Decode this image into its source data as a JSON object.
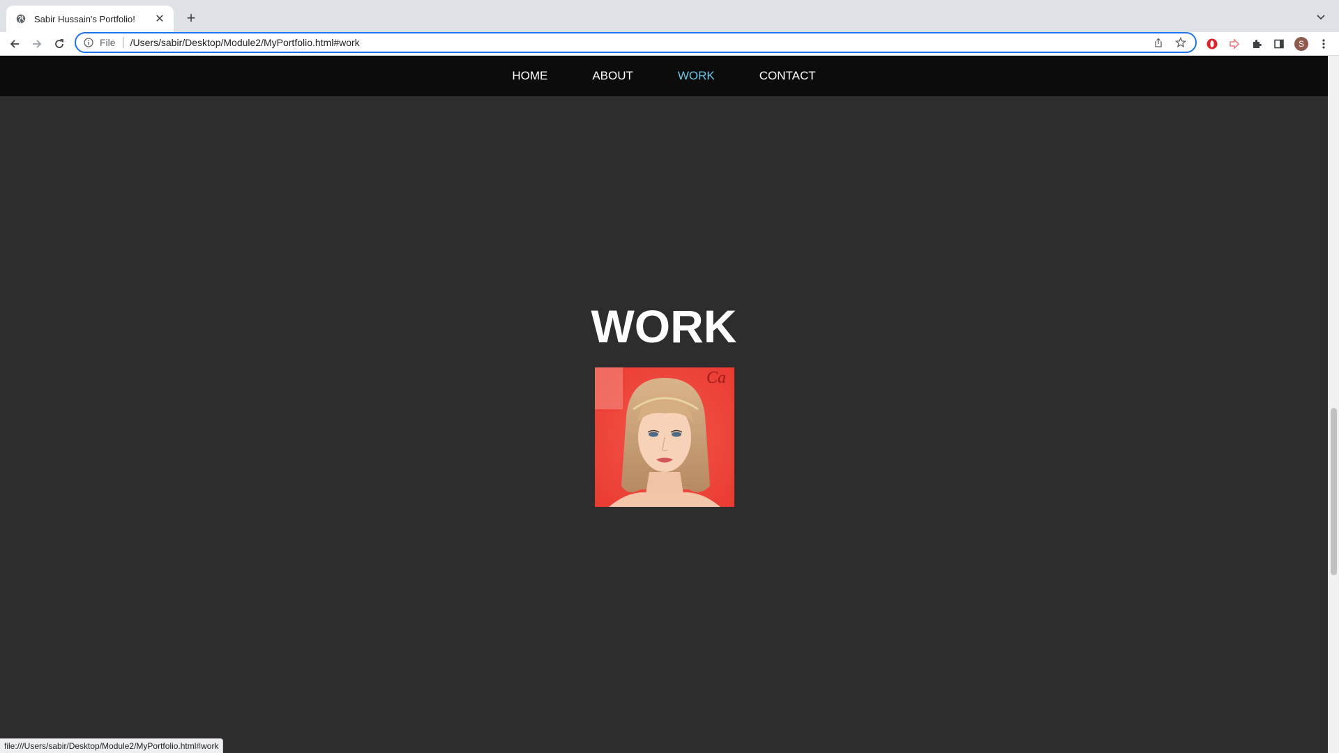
{
  "browser": {
    "tab_title": "Sabir Hussain's Portfolio!",
    "url_scheme": "File",
    "url": "/Users/sabir/Desktop/Module2/MyPortfolio.html#work",
    "profile_initial": "S",
    "status_url": "file:///Users/sabir/Desktop/Module2/MyPortfolio.html#work"
  },
  "nav": {
    "items": [
      {
        "label": "HOME"
      },
      {
        "label": "ABOUT"
      },
      {
        "label": "WORK"
      },
      {
        "label": "CONTACT"
      }
    ],
    "active_index": 2,
    "active_color": "#6ec3e8"
  },
  "section": {
    "heading": "WORK"
  }
}
